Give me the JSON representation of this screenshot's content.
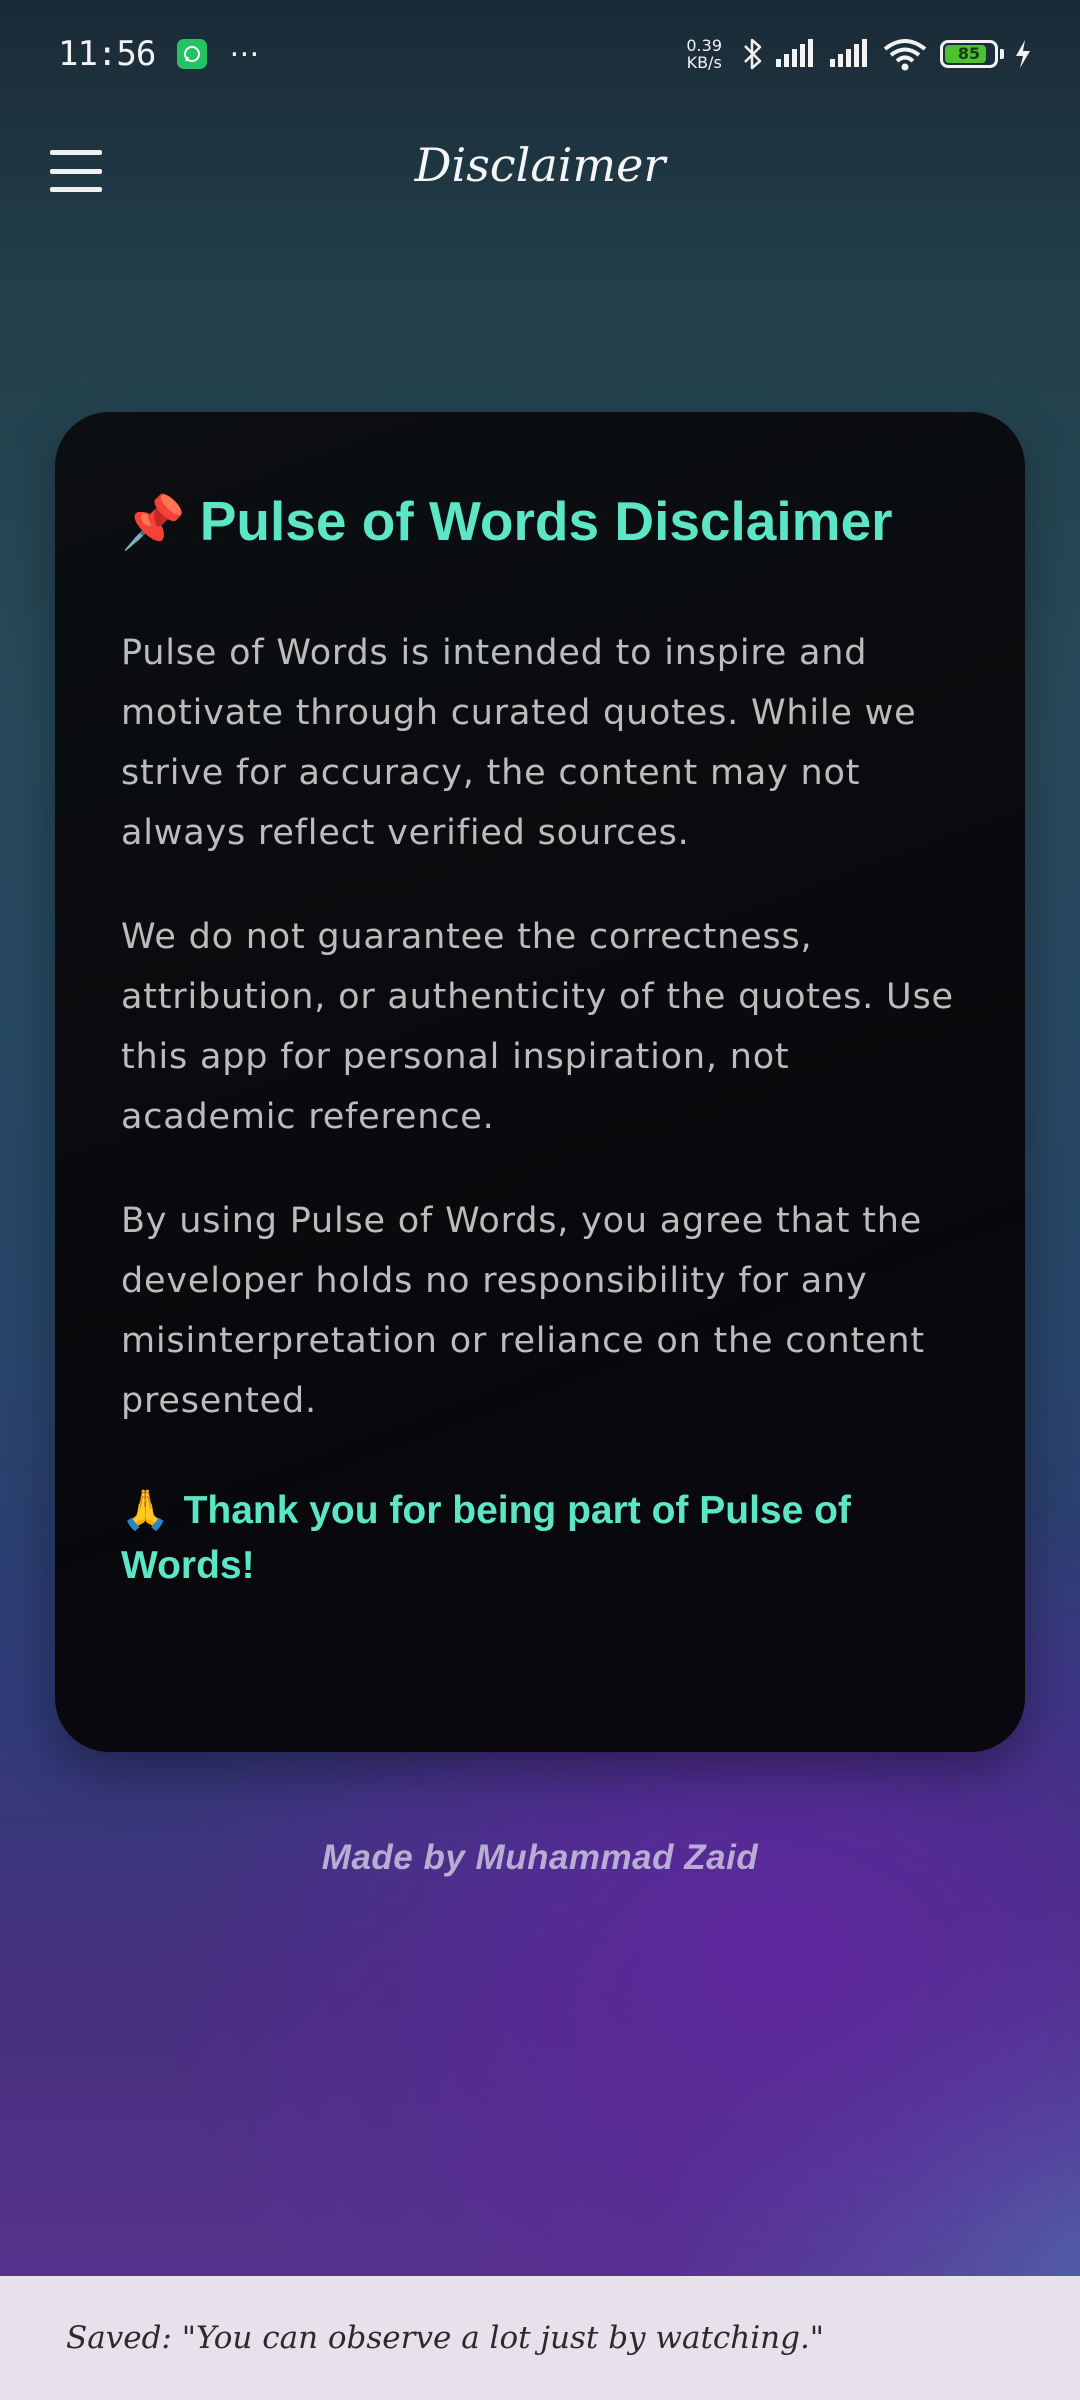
{
  "status_bar": {
    "time": "11:56",
    "net_speed_value": "0.39",
    "net_speed_unit": "KB/s",
    "battery_level": "85",
    "icons": [
      "whatsapp-icon",
      "more-dots-icon",
      "bluetooth-icon",
      "signal-icon",
      "signal-icon",
      "wifi-icon",
      "battery-icon",
      "charging-icon"
    ]
  },
  "app_bar": {
    "title": "Disclaimer",
    "menu_icon": "hamburger-menu-icon"
  },
  "card": {
    "title_emoji": "📌",
    "title": "Pulse of Words Disclaimer",
    "paragraphs": [
      "Pulse of Words is intended to inspire and motivate through curated quotes. While we strive for accuracy, the content may not always reflect verified sources.",
      "We do not guarantee the correctness, attribution, or authenticity of the quotes. Use this app for personal inspiration, not academic reference.",
      "By using Pulse of Words, you agree that the developer holds no responsibility for any misinterpretation or reliance on the content presented."
    ],
    "thanks_emoji": "🙏",
    "thanks": "Thank you for being part of Pulse of Words!"
  },
  "footer": {
    "credit": "Made by Muhammad Zaid"
  },
  "snackbar": {
    "text": "Saved: \"You can observe a lot just by watching.\""
  },
  "colors": {
    "accent": "#5de6c6",
    "card_background": "#08090c",
    "snackbar_background": "#e6e1ea"
  }
}
